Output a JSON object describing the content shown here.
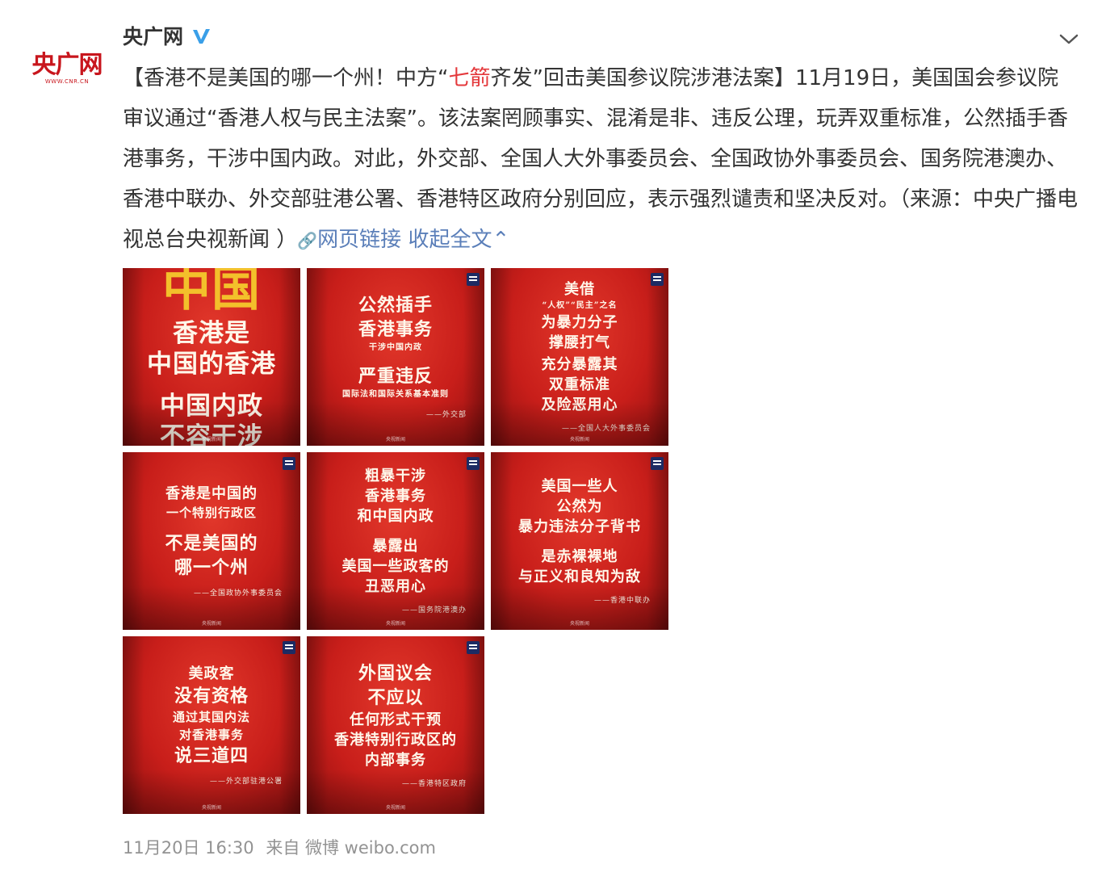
{
  "post": {
    "avatar_logo_text": "央广网",
    "avatar_logo_url": "WWW.CNR.CN",
    "username": "央广网",
    "content_before": "【香港不是美国的哪一个州！中方“",
    "content_highlight": "七箭",
    "content_after": "齐发”回击美国参议院涉港法案】11月19日，美国国会参议院审议通过“香港人权与民主法案”。该法案罔顾事实、混淆是非、违反公理，玩弄双重标准，公然插手香港事务，干涉中国内政。对此，外交部、全国人大外事委员会、全国政协外事委员会、国务院港澳办、香港中联办、外交部驻港公署、香港特区政府分别回应，表示强烈谴责和坚决反对。（来源：中央广播电视总台央视新闻 ）",
    "link_icon": "🔗",
    "link_label": "网页链接",
    "collapse_label": "收起全文",
    "collapse_arrow": "⌃",
    "timestamp": "11月20日 16:30",
    "source": "来自 微博 weibo.com"
  },
  "tiles": [
    {
      "big": "中国",
      "lines": [
        "香港是",
        "中国的香港",
        "中国内政",
        "不容干涉"
      ],
      "source": ""
    },
    {
      "lines": [
        "公然插手",
        "香港事务",
        "干涉中国内政",
        "严重违反",
        "国际法和国际关系基本准则"
      ],
      "source": "——外交部"
    },
    {
      "lines": [
        "美借",
        "“人权”“民主”之名",
        "为暴力分子",
        "撑腰打气",
        "充分暴露其",
        "双重标准",
        "及险恶用心"
      ],
      "source": "——全国人大外事委员会"
    },
    {
      "lines": [
        "香港是中国的",
        "一个特别行政区",
        "不是美国的",
        "哪一个州"
      ],
      "source": "——全国政协外事委员会"
    },
    {
      "lines": [
        "粗暴干涉",
        "香港事务",
        "和中国内政",
        "暴露出",
        "美国一些政客的",
        "丑恶用心"
      ],
      "source": "——国务院港澳办"
    },
    {
      "lines": [
        "美国一些人",
        "公然为",
        "暴力违法分子背书",
        "是赤裸裸地",
        "与正义和良知为敌"
      ],
      "source": "——香港中联办"
    },
    {
      "lines": [
        "美政客",
        "没有资格",
        "通过其国内法",
        "对香港事务",
        "说三道四"
      ],
      "source": "——外交部驻港公署"
    },
    {
      "lines": [
        "外国议会",
        "不应以",
        "任何形式干预",
        "香港特别行政区的",
        "内部事务"
      ],
      "source": "——香港特区政府"
    }
  ],
  "tile_footer": "央视新闻",
  "colors": {
    "accent_red": "#e4393c",
    "link_blue": "#5b7fb9",
    "verified_blue": "#3a9fe8",
    "timestamp_gray": "#939393"
  }
}
